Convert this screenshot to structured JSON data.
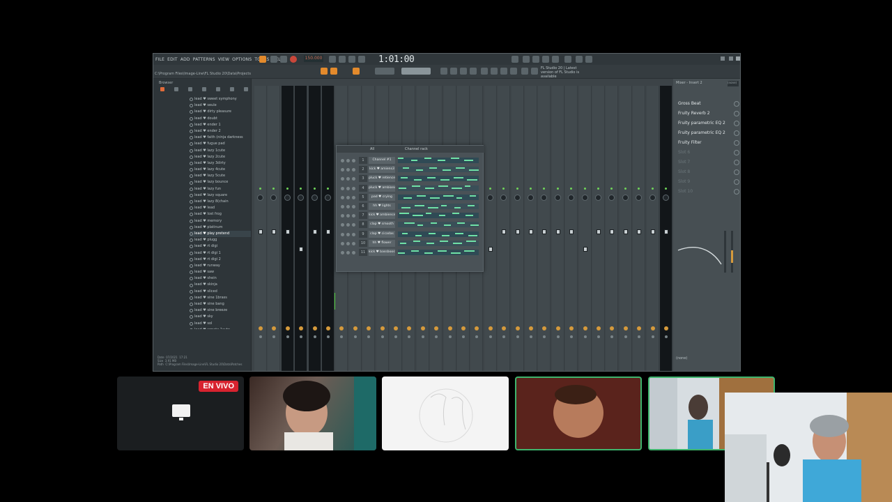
{
  "app": {
    "menu": [
      "FILE",
      "EDIT",
      "ADD",
      "PATTERNS",
      "VIEW",
      "OPTIONS",
      "TOOLS",
      "?",
      "HELP"
    ],
    "tempo": "150.000",
    "time": "1:01:00",
    "hint_text": "FL Studio 20 | Latest version of FL Studio is available",
    "path": "C:\\Program Files\\Image-Line\\FL Studio 20\\Data\\Projects",
    "browser_title": "Browser",
    "file_info": "Date  07/2021  17:21\nSize  3.91 MB\nPath  C:\\Program Files\\Image-Line\\FL Studio 20\\Data\\Patches"
  },
  "browser": {
    "files": [
      "lead ♥ sweet symphony",
      "lead ♥ seule",
      "lead ♥ dirty pleasure",
      "lead ♥ doubt",
      "lead ♥ ender 1",
      "lead ♥ ender 2",
      "lead ♥ faith (ninja darkness",
      "lead ♥ fugue pad",
      "lead ♥ lazy 1cute",
      "lead ♥ lazy 2cute",
      "lead ♥ lazy 3dirty",
      "lead ♥ lazy 4cute",
      "lead ♥ lazy 5cute",
      "lead ♥ lazy bounce",
      "lead ♥ lazy fun",
      "lead ♥ lazy square",
      "lead ♥ lazy 8(chain",
      "lead ♥ lead",
      "lead ♥ lost frog",
      "lead ♥ memory",
      "lead ♥ platinum",
      "lead ♥ play pretend",
      "lead ♥ plugg",
      "lead ♥ rt digi",
      "lead ♥ rt digi 1",
      "lead ♥ rt digi 2",
      "lead ♥ runway",
      "lead ♥ saw",
      "lead ♥ shein",
      "lead ♥ skinja",
      "lead ♥ sliced",
      "lead ♥ sine 1brass",
      "lead ♥ sine bang",
      "lead ♥ sine breeze",
      "lead ♥ sky",
      "lead ♥ sol",
      "lead ♥ sonata 1cute"
    ],
    "selected_index": 21
  },
  "channel_rack": {
    "title": "Channel rack",
    "filter": "All",
    "rows": [
      {
        "num": "1",
        "name": "Channel #1"
      },
      {
        "num": "2",
        "name": "kick ♥ amiens3"
      },
      {
        "num": "3",
        "name": "pluck ♥ retience"
      },
      {
        "num": "4",
        "name": "pluck ♥ ambiance"
      },
      {
        "num": "5",
        "name": "pad ♥ crying"
      },
      {
        "num": "6",
        "name": "hh ♥ lights"
      },
      {
        "num": "7",
        "name": "kick ♥ ambience"
      },
      {
        "num": "8",
        "name": "clap ♥ smooth"
      },
      {
        "num": "9",
        "name": "clap ♥ cicadas"
      },
      {
        "num": "10",
        "name": "hh ♥ flower"
      },
      {
        "num": "11",
        "name": "kick ♥ bassboost"
      }
    ]
  },
  "insert": {
    "header": "Mixer - Insert 2",
    "name_field": "(none)",
    "slots": [
      "Gross Beat",
      "Fruity Reverb 2",
      "Fruity parametric EQ 2",
      "Fruity parametric EQ 2",
      "Fruity Filter",
      "Slot 6",
      "Slot 7",
      "Slot 8",
      "Slot 9",
      "Slot 10"
    ],
    "bottom": "(none)"
  },
  "call": {
    "live_badge": "EN VIVO",
    "tiles": [
      "screen-share",
      "participant-2",
      "participant-3",
      "participant-4",
      "participant-5"
    ],
    "active_tile": 3
  }
}
